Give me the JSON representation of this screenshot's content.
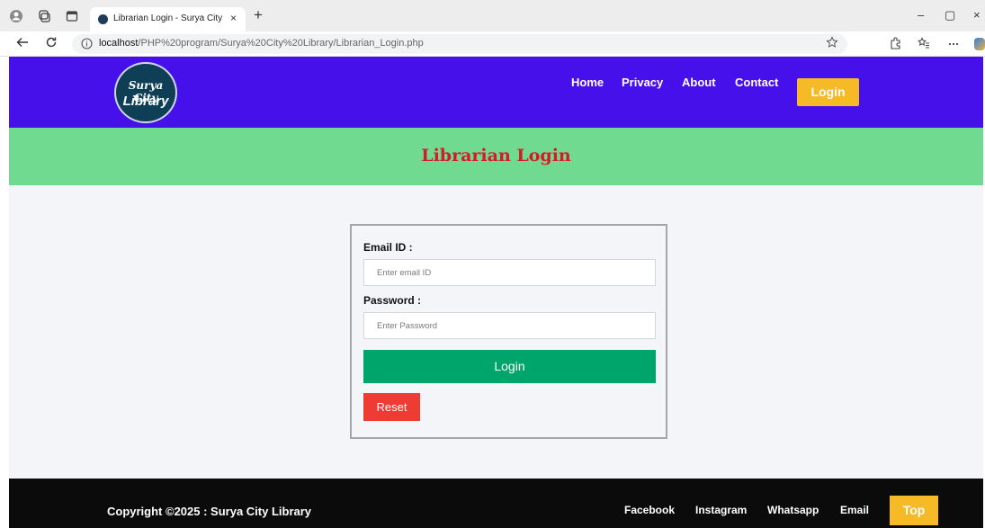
{
  "browser": {
    "tab_title": "Librarian Login - Surya City Library",
    "tab_close": "×",
    "new_tab": "+",
    "url_host": "localhost",
    "url_path": "/PHP%20program/Surya%20City%20Library/Librarian_Login.php",
    "icons": [
      "profile-icon",
      "workspaces-icon",
      "tab-actions-icon",
      "back-icon",
      "refresh-icon",
      "info-icon",
      "favorite-star-icon",
      "extensions-icon",
      "favorites-icon",
      "more-icon",
      "copilot-icon"
    ],
    "window_controls": [
      "–",
      "▢",
      "×"
    ]
  },
  "navbar": {
    "logo_line1": "Surya City",
    "logo_line2": "Library",
    "links": [
      "Home",
      "Privacy",
      "About",
      "Contact"
    ],
    "login_label": "Login",
    "colors": {
      "background": "#4610ea",
      "login_button": "#f5ba26"
    }
  },
  "hero": {
    "title": "Librarian Login",
    "colors": {
      "background": "#70da90",
      "title": "#d31c28"
    }
  },
  "form": {
    "email_label": "Email ID :",
    "email_placeholder": "Enter email ID",
    "password_label": "Password :",
    "password_placeholder": "Enter Password",
    "login_label": "Login",
    "reset_label": "Reset",
    "colors": {
      "login_button": "#00a56c",
      "reset_button": "#ee3b33"
    }
  },
  "footer": {
    "copyright": "Copyright ©2025 : Surya City Library",
    "links": [
      "Facebook",
      "Instagram",
      "Whatsapp",
      "Email"
    ],
    "top_label": "Top",
    "colors": {
      "background": "#0b0b0b",
      "top_button": "#f5ba26"
    }
  }
}
